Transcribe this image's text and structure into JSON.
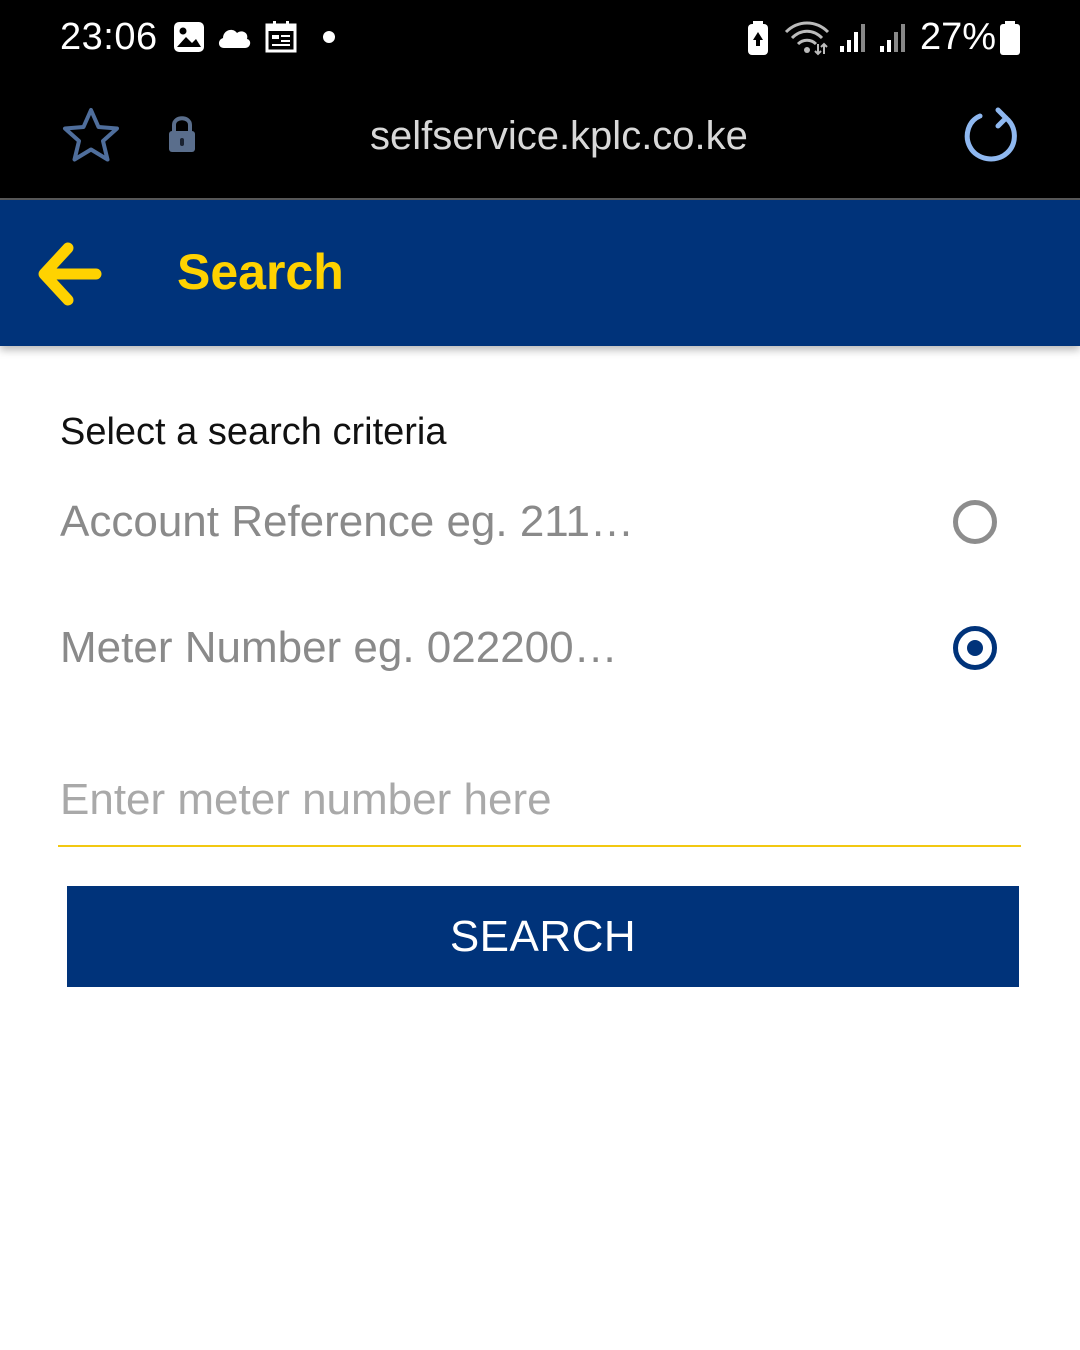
{
  "status_bar": {
    "time": "23:06",
    "battery_percent": "27%",
    "left_icons": [
      "gallery-icon",
      "cloud-icon",
      "calendar-icon",
      "notification-dot-icon"
    ],
    "right_icons": [
      "battery-saver-icon",
      "wifi-icon",
      "signal-icon",
      "signal-icon",
      "battery-icon"
    ]
  },
  "browser": {
    "url": "selfservice.kplc.co.ke",
    "icons": [
      "star-icon",
      "lock-icon",
      "reload-icon"
    ]
  },
  "header": {
    "title": "Search",
    "back_icon": "arrow-left-icon"
  },
  "form": {
    "criteria_label": "Select a search criteria",
    "options": [
      {
        "label": "Account Reference eg. 211…",
        "selected": false
      },
      {
        "label": "Meter Number eg. 022200…",
        "selected": true
      }
    ],
    "input_placeholder": "Enter meter number here",
    "input_value": "",
    "search_button_label": "SEARCH"
  },
  "colors": {
    "brand_blue": "#00337a",
    "brand_yellow": "#ffd200",
    "underline_yellow": "#f2c811"
  }
}
